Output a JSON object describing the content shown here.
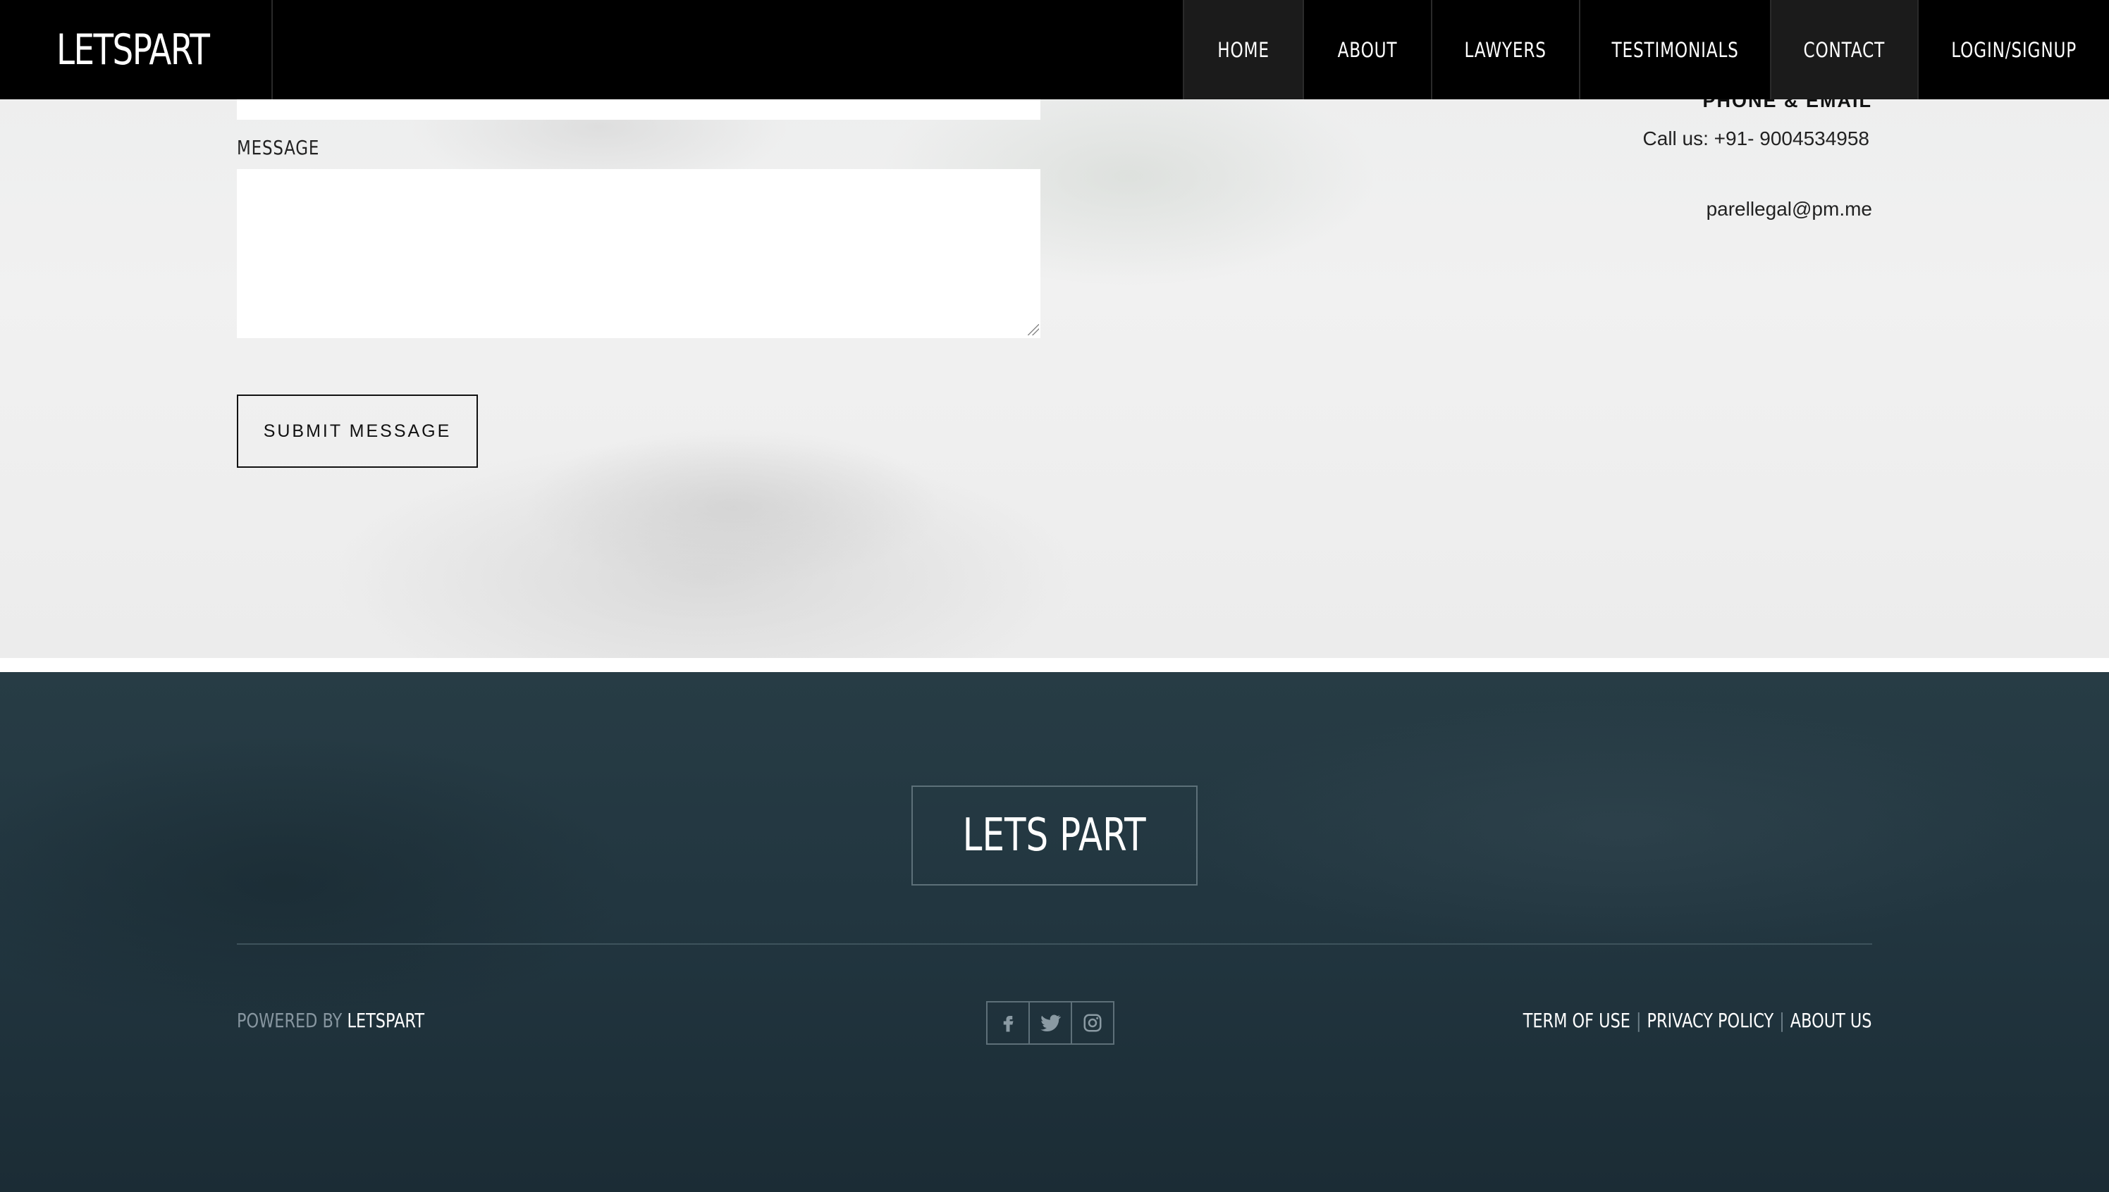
{
  "nav": {
    "brand": "LETSPART",
    "items": [
      {
        "label": "HOME"
      },
      {
        "label": "ABOUT"
      },
      {
        "label": "LAWYERS"
      },
      {
        "label": "TESTIMONIALS"
      },
      {
        "label": "CONTACT"
      },
      {
        "label": "LOGIN/SIGNUP"
      }
    ]
  },
  "contact": {
    "message_label": "MESSAGE",
    "message_value": "",
    "submit_label": "SUBMIT MESSAGE",
    "info_title": "PHONE & EMAIL",
    "phone": "Call us: +91- 9004534958",
    "email": "parellegal@pm.me"
  },
  "footer": {
    "logo": "LETS PART",
    "powered_prefix": "POWERED BY",
    "powered_brand": "LETSPART",
    "social": [
      "facebook-icon",
      "twitter-icon",
      "instagram-icon"
    ],
    "links": [
      {
        "label": "TERM OF USE"
      },
      {
        "label": "PRIVACY POLICY"
      },
      {
        "label": "ABOUT US"
      }
    ]
  },
  "colors": {
    "nav_bg": "#000000",
    "footer_bg": "#223640",
    "page_bg": "#efefef"
  }
}
